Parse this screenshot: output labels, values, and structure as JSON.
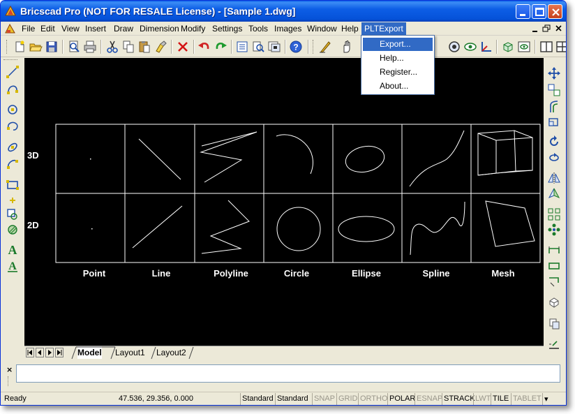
{
  "window": {
    "title": "Bricscad Pro (NOT FOR RESALE License) - [Sample 1.dwg]"
  },
  "menubar": {
    "items": [
      "File",
      "Edit",
      "View",
      "Insert",
      "Draw",
      "Dimension",
      "Modify",
      "Settings",
      "Tools",
      "Images",
      "Window",
      "Help",
      "PLTExport"
    ],
    "active": "PLTExport"
  },
  "dropdown": {
    "items": [
      "Export...",
      "Help...",
      "Register...",
      "About..."
    ],
    "highlighted": "Export..."
  },
  "toolbar": {
    "icons": [
      "new-file-icon",
      "open-folder-icon",
      "save-icon",
      "print-preview-icon",
      "print-icon",
      "cut-icon",
      "copy-icon",
      "paste-icon",
      "match-properties-icon",
      "delete-icon",
      "undo-icon",
      "redo-icon",
      "properties-icon",
      "design-center-icon",
      "layer-manager-icon",
      "help-icon",
      "pen-icon",
      "pan-icon",
      "zoom-icon",
      "render-icon",
      "visibility-icon",
      "ucs-icon",
      "3d-view-icon",
      "named-views-icon",
      "tile-viewports-icon",
      "split-viewports-icon"
    ]
  },
  "drawing": {
    "row_labels": [
      "3D",
      "2D"
    ],
    "column_labels": [
      "Point",
      "Line",
      "Polyline",
      "Circle",
      "Ellipse",
      "Spline",
      "Mesh"
    ]
  },
  "tabs": {
    "items": [
      "Model",
      "Layout1",
      "Layout2"
    ],
    "active": "Model"
  },
  "command": {
    "close_label": "×",
    "value": ""
  },
  "status": {
    "ready": "Ready",
    "coords": "47.536, 29.356, 0.000",
    "cells": [
      {
        "label": "Standard",
        "on": true
      },
      {
        "label": "Standard",
        "on": true
      },
      {
        "label": "SNAP",
        "on": false
      },
      {
        "label": "GRID",
        "on": false
      },
      {
        "label": "ORTHO",
        "on": false
      },
      {
        "label": "POLAR",
        "on": true
      },
      {
        "label": "ESNAP",
        "on": false
      },
      {
        "label": "STRACK",
        "on": true
      },
      {
        "label": "LWT",
        "on": false
      },
      {
        "label": "TILE",
        "on": true
      },
      {
        "label": "TABLET",
        "on": false
      }
    ],
    "arrow": "▾"
  },
  "colors": {
    "canvas": "#000000",
    "title_blue": "#0552d8",
    "menu_highlight": "#316ac5",
    "chrome": "#ece9d8"
  }
}
